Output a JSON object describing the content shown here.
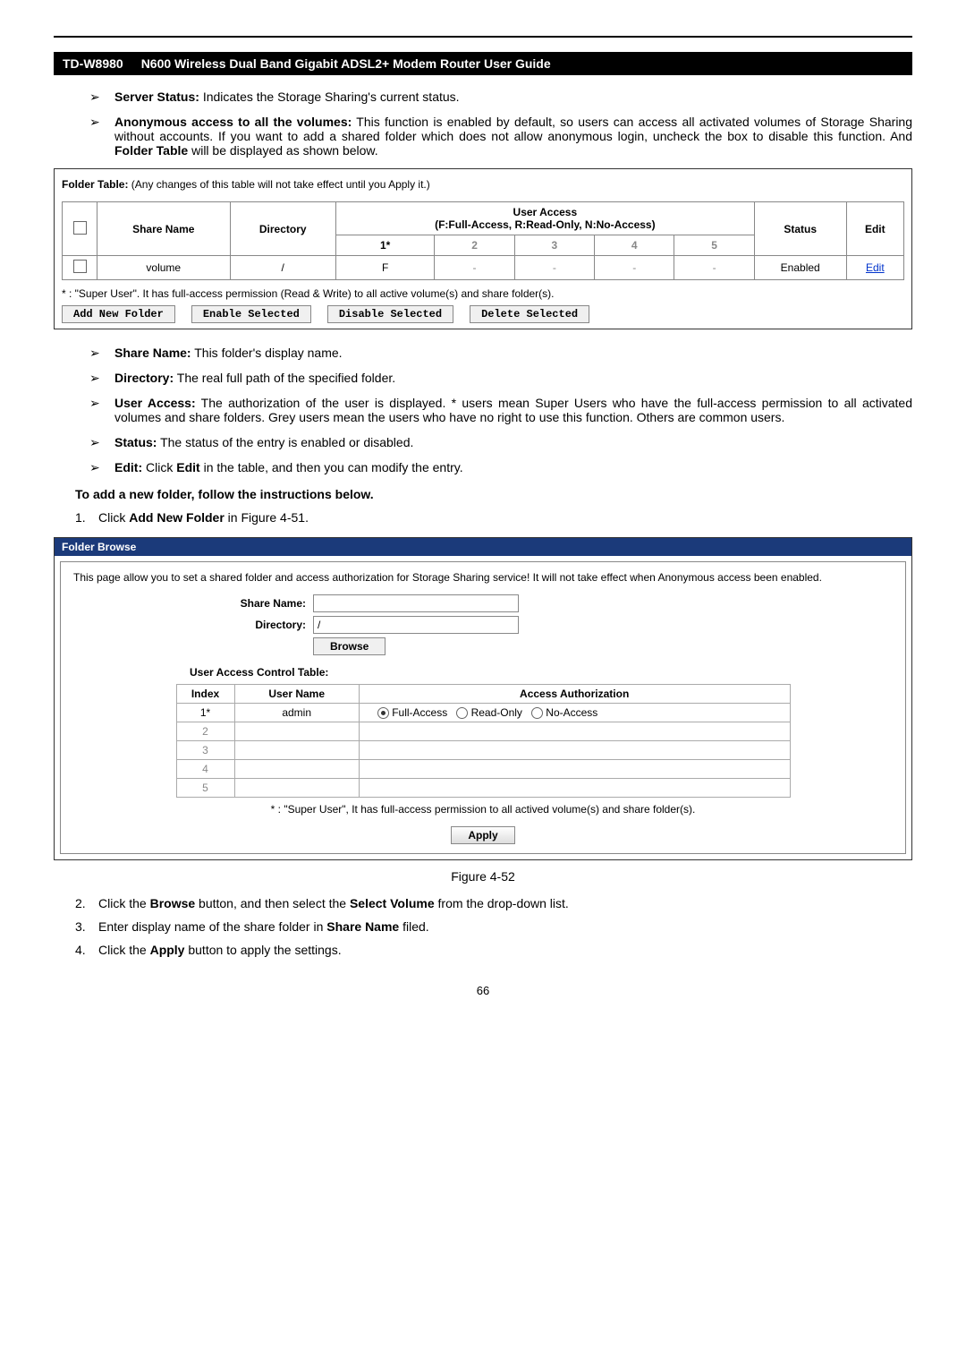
{
  "header": {
    "model": "TD-W8980",
    "title": "N600 Wireless Dual Band Gigabit ADSL2+ Modem Router User Guide"
  },
  "bullets1": [
    {
      "label": "Server Status:",
      "text": " Indicates the Storage Sharing's current status."
    },
    {
      "label": "Anonymous access to all the volumes:",
      "text": " This function is enabled by default, so users can access all activated volumes of Storage Sharing without accounts. If you want to add a shared folder which does not allow anonymous login, uncheck the box to disable this function. And ",
      "label2": "Folder Table",
      "text2": " will be displayed as shown below."
    }
  ],
  "folderTable": {
    "caption": "Folder Table: (Any changes of this table will not take effect until you Apply it.)",
    "headers": {
      "shareName": "Share Name",
      "directory": "Directory",
      "userAccess": "User Access",
      "userAccessSub": "(F:Full-Access, R:Read-Only, N:No-Access)",
      "status": "Status",
      "edit": "Edit",
      "cols": [
        "1*",
        "2",
        "3",
        "4",
        "5"
      ]
    },
    "row": {
      "shareName": "volume",
      "directory": "/",
      "access": [
        "F",
        "-",
        "-",
        "-",
        "-"
      ],
      "status": "Enabled",
      "edit": "Edit"
    },
    "note": "* : \"Super User\". It has full-access permission (Read & Write) to all active volume(s) and share folder(s).",
    "buttons": [
      "Add New Folder",
      "Enable Selected",
      "Disable Selected",
      "Delete Selected"
    ]
  },
  "bullets2": [
    {
      "label": "Share Name:",
      "text": " This folder's display name."
    },
    {
      "label": "Directory:",
      "text": " The real full path of the specified folder."
    },
    {
      "label": "User Access:",
      "text": " The authorization of the user is displayed. * users mean Super Users who have the full-access permission to all activated volumes and share folders. Grey users mean the users who have no right to use this function. Others are common users."
    },
    {
      "label": "Status:",
      "text": " The status of the entry is enabled or disabled."
    },
    {
      "label": "Edit:",
      "text": " Click ",
      "label2": "Edit",
      "text2": " in the table, and then you can modify the entry."
    }
  ],
  "instruction": "To add a new folder, follow the instructions below.",
  "step1": {
    "num": "1.",
    "pre": "Click ",
    "bold": "Add New Folder",
    "post": " in Figure 4-51."
  },
  "folderBrowse": {
    "title": "Folder Browse",
    "desc": "This page allow you to set a shared folder and access authorization for Storage Sharing service! It will not take effect when Anonymous access been enabled.",
    "shareNameLabel": "Share Name:",
    "directoryLabel": "Directory:",
    "directoryValue": "/",
    "browseBtn": "Browse",
    "accessTableTitle": "User Access Control Table:",
    "accessHeaders": {
      "index": "Index",
      "userName": "User Name",
      "auth": "Access Authorization"
    },
    "accessRow": {
      "index": "1*",
      "userName": "admin",
      "opts": [
        "Full-Access",
        "Read-Only",
        "No-Access"
      ],
      "selected": 0
    },
    "emptyRows": [
      "2",
      "3",
      "4",
      "5"
    ],
    "note": "* : \"Super User\", It has full-access permission to all actived volume(s) and share folder(s).",
    "applyBtn": "Apply"
  },
  "figureCaption": "Figure 4-52",
  "steps234": [
    {
      "num": "2.",
      "pre": "Click the ",
      "b1": "Browse",
      "mid": " button, and then select the ",
      "b2": "Select Volume",
      "post": " from the drop-down list."
    },
    {
      "num": "3.",
      "pre": "Enter display name of the share folder in ",
      "b1": "Share Name",
      "post": " filed."
    },
    {
      "num": "4.",
      "pre": "Click the ",
      "b1": "Apply",
      "post": " button to apply the settings."
    }
  ],
  "pageNum": "66"
}
